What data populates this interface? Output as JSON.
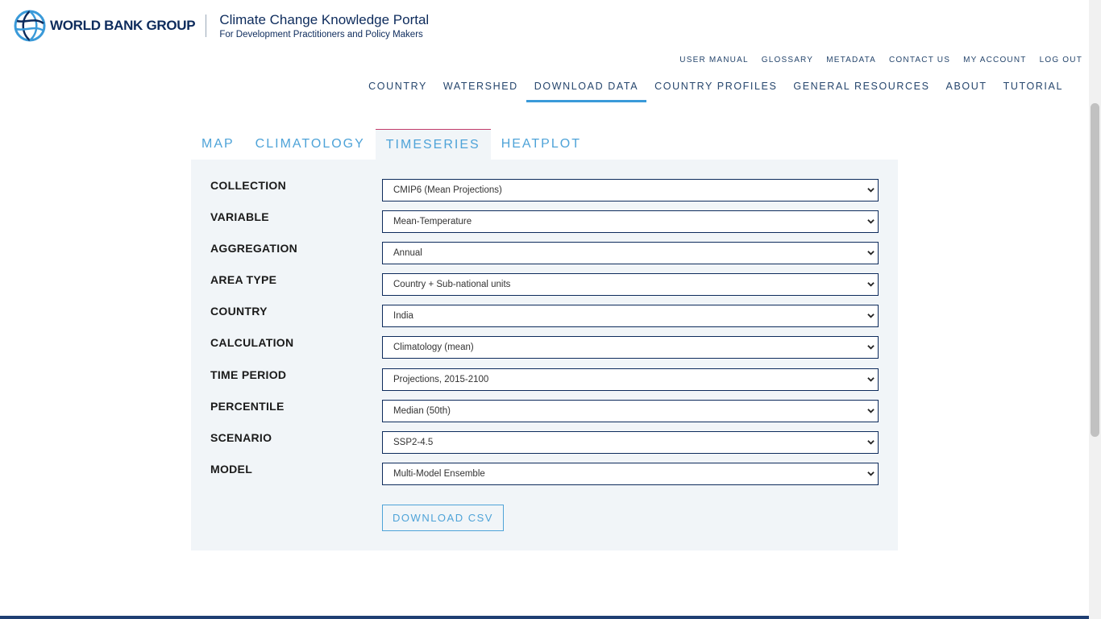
{
  "header": {
    "brand": "WORLD BANK GROUP",
    "portal_title": "Climate Change Knowledge Portal",
    "portal_subtitle": "For Development Practitioners and Policy Makers"
  },
  "utility_nav": [
    "USER MANUAL",
    "GLOSSARY",
    "METADATA",
    "CONTACT US",
    "MY ACCOUNT",
    "LOG OUT"
  ],
  "main_nav": {
    "items": [
      "COUNTRY",
      "WATERSHED",
      "DOWNLOAD DATA",
      "COUNTRY PROFILES",
      "GENERAL RESOURCES",
      "ABOUT",
      "TUTORIAL"
    ],
    "active": "DOWNLOAD DATA"
  },
  "tabs": {
    "items": [
      "MAP",
      "CLIMATOLOGY",
      "TIMESERIES",
      "HEATPLOT"
    ],
    "active": "TIMESERIES"
  },
  "form": {
    "fields": [
      {
        "label": "COLLECTION",
        "value": "CMIP6 (Mean Projections)"
      },
      {
        "label": "VARIABLE",
        "value": "Mean-Temperature"
      },
      {
        "label": "AGGREGATION",
        "value": "Annual"
      },
      {
        "label": "AREA TYPE",
        "value": "Country + Sub-national units"
      },
      {
        "label": "COUNTRY",
        "value": "India"
      },
      {
        "label": "CALCULATION",
        "value": "Climatology (mean)"
      },
      {
        "label": "TIME PERIOD",
        "value": "Projections, 2015-2100"
      },
      {
        "label": "PERCENTILE",
        "value": "Median (50th)"
      },
      {
        "label": "SCENARIO",
        "value": "SSP2-4.5"
      },
      {
        "label": "MODEL",
        "value": "Multi-Model Ensemble"
      }
    ],
    "download_label": "DOWNLOAD CSV"
  },
  "colors": {
    "brand_navy": "#0d2b5c",
    "accent_blue": "#4ea3d8",
    "active_tab_border": "#c23b6a",
    "panel_bg": "#f1f5f8"
  }
}
